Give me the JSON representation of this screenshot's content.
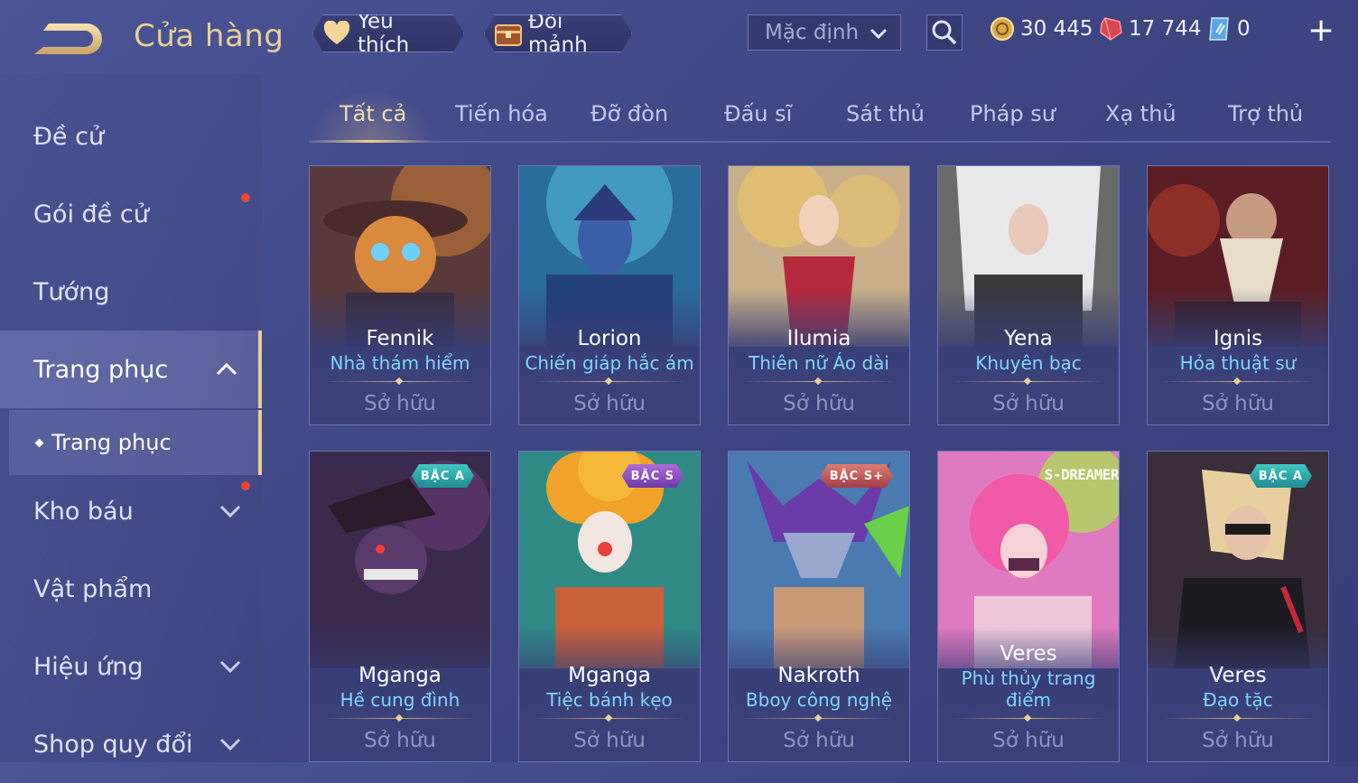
{
  "header": {
    "title": "Cửa hàng",
    "favorites_label": "Yêu thích",
    "exchange_label": "Đổi mảnh",
    "sort_value": "Mặc định",
    "currencies": {
      "gold": "30 445",
      "gems": "17 744",
      "vouchers": "0"
    }
  },
  "sidebar": {
    "items": [
      {
        "label": "Đề cử"
      },
      {
        "label": "Gói đề cử"
      },
      {
        "label": "Tướng"
      },
      {
        "label": "Trang phục"
      },
      {
        "label": "Kho báu"
      },
      {
        "label": "Vật phẩm"
      },
      {
        "label": "Hiệu ứng"
      },
      {
        "label": "Shop quy đổi"
      }
    ],
    "sub_item": "Trang phục"
  },
  "tabs": [
    "Tất cả",
    "Tiến hóa",
    "Đỡ đòn",
    "Đấu sĩ",
    "Sát thủ",
    "Pháp sư",
    "Xạ thủ",
    "Trợ thủ"
  ],
  "cards": [
    {
      "hero": "Fennik",
      "skin": "Nhà thám hiểm",
      "status": "Sở hữu",
      "tier": ""
    },
    {
      "hero": "Lorion",
      "skin": "Chiến giáp hắc ám",
      "status": "Sở hữu",
      "tier": ""
    },
    {
      "hero": "Ilumia",
      "skin": "Thiên nữ Áo dài",
      "status": "Sở hữu",
      "tier": ""
    },
    {
      "hero": "Yena",
      "skin": "Khuyên bạc",
      "status": "Sở hữu",
      "tier": ""
    },
    {
      "hero": "Ignis",
      "skin": "Hỏa thuật sư",
      "status": "Sở hữu",
      "tier": ""
    },
    {
      "hero": "Mganga",
      "skin": "Hề cung đình",
      "status": "Sở hữu",
      "tier": "BẬC A"
    },
    {
      "hero": "Mganga",
      "skin": "Tiệc bánh kẹo",
      "status": "Sở hữu",
      "tier": "BẬC S"
    },
    {
      "hero": "Nakroth",
      "skin": "Bboy công nghệ",
      "status": "Sở hữu",
      "tier": "BẬC S+"
    },
    {
      "hero": "Veres",
      "skin": "Phù thủy trang điểm",
      "status": "Sở hữu",
      "tier": "S-DREAMER"
    },
    {
      "hero": "Veres",
      "skin": "Đạo tặc",
      "status": "Sở hữu",
      "tier": "BẬC A"
    }
  ],
  "colors": {
    "accent_gold": "#e8cf96",
    "skin_name": "#7fd6ff",
    "notification": "#e8473e"
  }
}
